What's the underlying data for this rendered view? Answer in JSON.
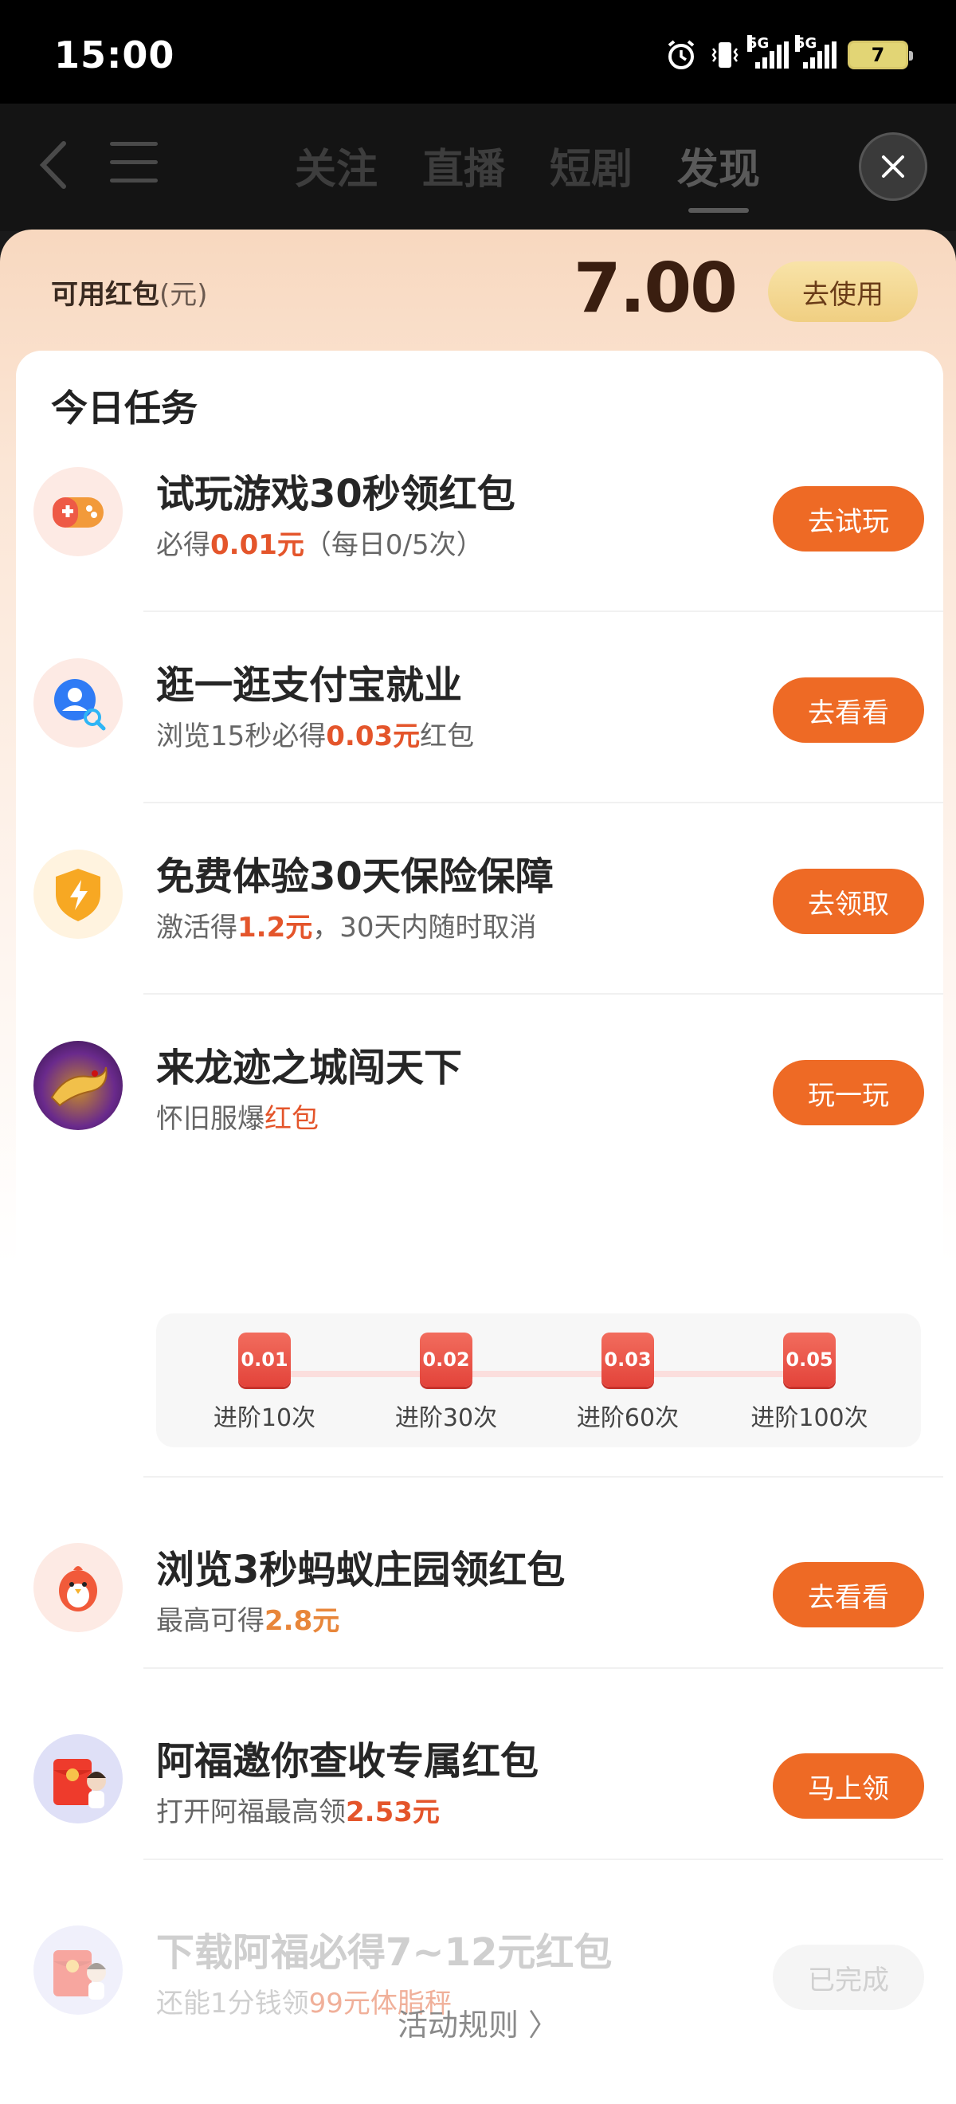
{
  "status_bar": {
    "time": "15:00",
    "battery": "7",
    "net1": "5G",
    "net2": "5G"
  },
  "nav": {
    "tabs": [
      "关注",
      "直播",
      "短剧",
      "发现"
    ],
    "active_tab": 3
  },
  "wallet": {
    "label": "可用红包",
    "unit": "(元)",
    "amount": "7.00",
    "use_button": "去使用"
  },
  "tasks_title": "今日任务",
  "tasks": [
    {
      "title": "试玩游戏30秒领红包",
      "desc_a": "必得",
      "desc_hl": "0.01元",
      "desc_b": "（每日0/5次）",
      "button": "去试玩",
      "icon": "gamepad-icon"
    },
    {
      "title": "逛一逛支付宝就业",
      "desc_a": "浏览15秒必得",
      "desc_hl": "0.03元",
      "desc_b": "红包",
      "button": "去看看",
      "icon": "job-search-icon"
    },
    {
      "title": "免费体验30天保险保障",
      "desc_a": "激活得",
      "desc_hl": "1.2元",
      "desc_b": "，30天内随时取消",
      "button": "去领取",
      "icon": "shield-icon"
    },
    {
      "title": "来龙迹之城闯天下",
      "desc_a": "怀旧服爆",
      "desc_hl": "红包",
      "desc_b": "",
      "button": "玩一玩",
      "icon": "game-dragon-icon"
    },
    {
      "title": "浏览3秒蚂蚁庄园领红包",
      "desc_a": "最高可得",
      "desc_hl": "2.8元",
      "desc_b": "",
      "button": "去看看",
      "icon": "chick-icon"
    },
    {
      "title": "阿福邀你查收专属红包",
      "desc_a": "打开阿福最高领",
      "desc_hl": "2.53元",
      "desc_b": "",
      "button": "马上领",
      "icon": "red-envelope-icon"
    },
    {
      "title": "下载阿福必得7~12元红包",
      "desc_a": "还能1分钱领",
      "desc_hl": "99元体脂秤",
      "desc_b": "",
      "button": "已完成",
      "icon": "red-envelope-icon"
    }
  ],
  "progress_steps": [
    {
      "amount": "0.01",
      "label": "进阶10次"
    },
    {
      "amount": "0.02",
      "label": "进阶30次"
    },
    {
      "amount": "0.03",
      "label": "进阶60次"
    },
    {
      "amount": "0.05",
      "label": "进阶100次"
    }
  ],
  "footer": {
    "rules_label": "活动规则"
  },
  "colors": {
    "accent": "#ee6a25",
    "highlight": "#e4552b",
    "gold": "#e8863a",
    "sheet_top": "#f8d8bf"
  }
}
